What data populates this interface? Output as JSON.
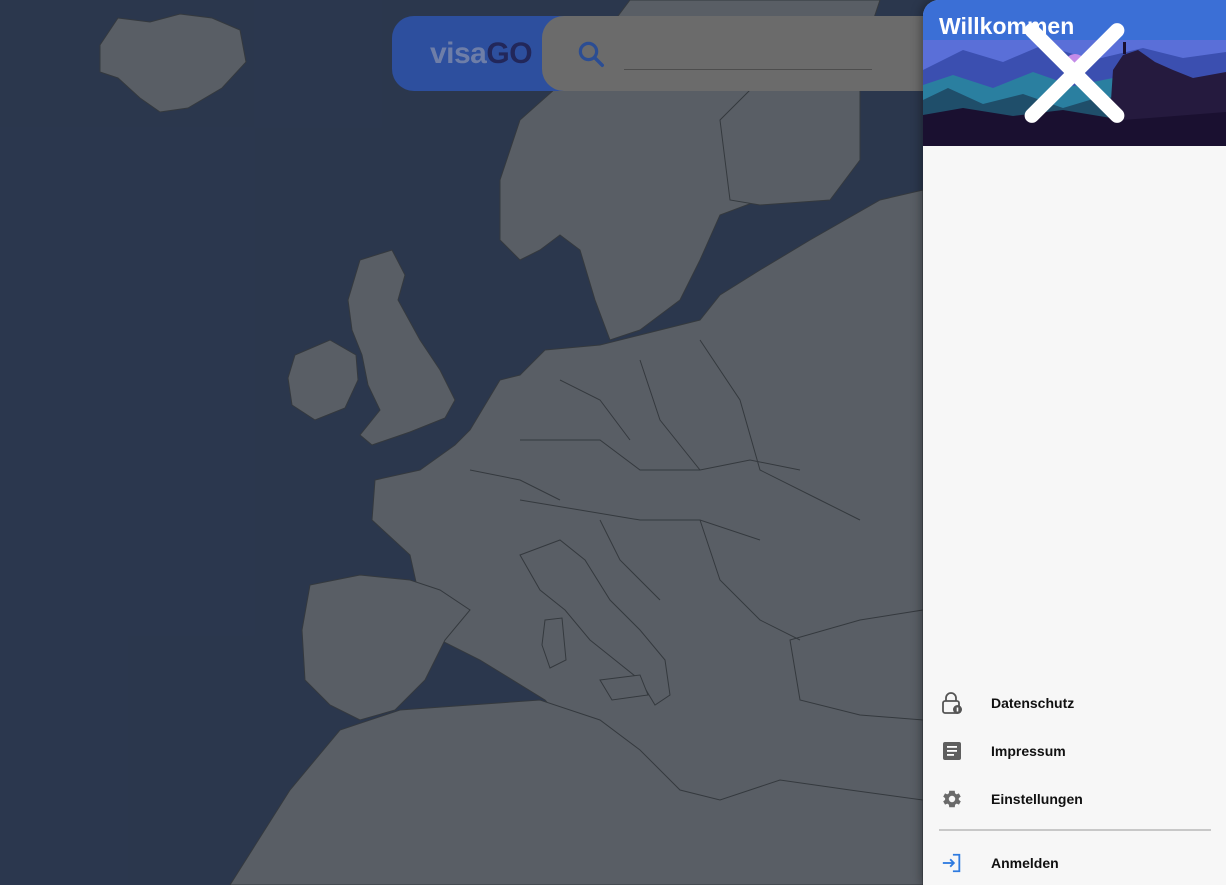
{
  "app": {
    "logo_part1": "visa",
    "logo_part2": "GO"
  },
  "search": {
    "value": "",
    "placeholder": ""
  },
  "drawer": {
    "title": "Willkommen",
    "items": [
      {
        "label": "Datenschutz",
        "icon": "lock-icon"
      },
      {
        "label": "Impressum",
        "icon": "document-icon"
      },
      {
        "label": "Einstellungen",
        "icon": "gear-icon"
      }
    ],
    "login": {
      "label": "Anmelden",
      "icon": "login-icon"
    }
  },
  "colors": {
    "brand_blue": "#3b6fd6",
    "logo_dark": "#22275a",
    "sea": "#4a5f86",
    "land": "#9aa3ae"
  }
}
